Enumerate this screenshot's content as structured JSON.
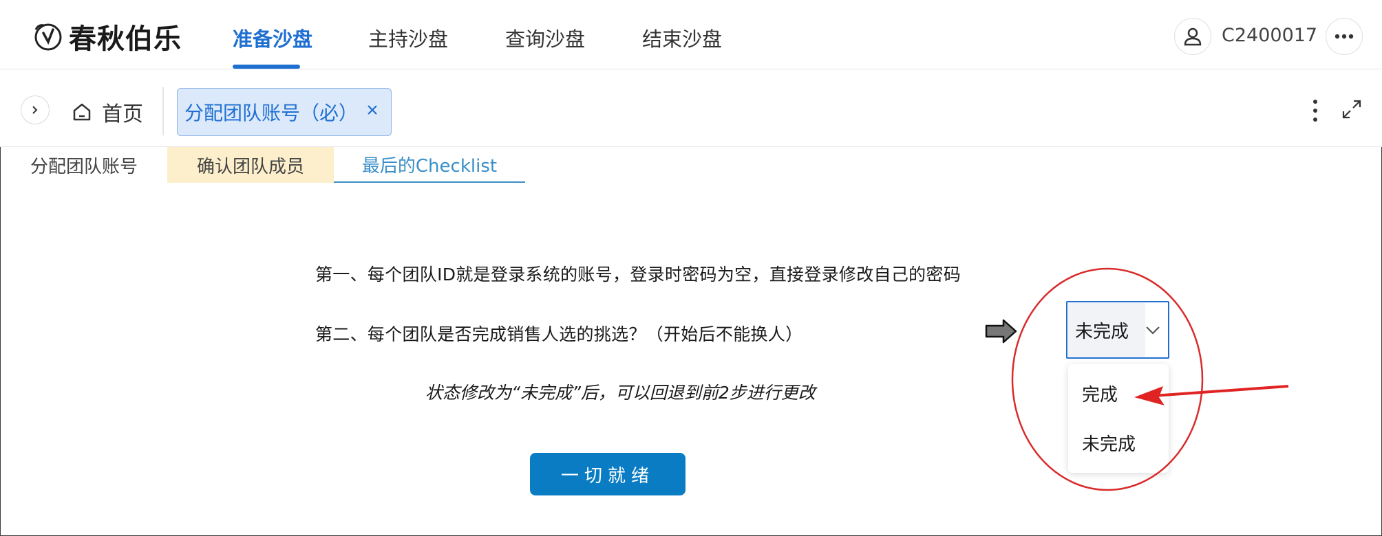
{
  "header": {
    "logo_text": "春秋伯乐",
    "nav": [
      {
        "label": "准备沙盘",
        "active": true
      },
      {
        "label": "主持沙盘",
        "active": false
      },
      {
        "label": "查询沙盘",
        "active": false
      },
      {
        "label": "结束沙盘",
        "active": false
      }
    ],
    "user_id": "C2400017",
    "accent_color": "#1f6fd1"
  },
  "tagbar": {
    "home_label": "首页",
    "open_tag": "分配团队账号（必）"
  },
  "steps": [
    {
      "label": "分配团队账号",
      "state": "plain"
    },
    {
      "label": "确认团队成员",
      "state": "highlighted"
    },
    {
      "label": "最后的Checklist",
      "state": "active"
    }
  ],
  "checklist": {
    "item1": "第一、每个团队ID就是登录系统的账号，登录时密码为空，直接登录修改自己的密码",
    "item2": "第二、每个团队是否完成销售人选的挑选？（开始后不能换人）",
    "hint": "状态修改为“未完成”后，可以回退到前2步进行更改",
    "status_value": "未完成",
    "options": [
      "完成",
      "未完成"
    ],
    "ready_button": "一切就绪",
    "button_color": "#0a7cc4"
  }
}
